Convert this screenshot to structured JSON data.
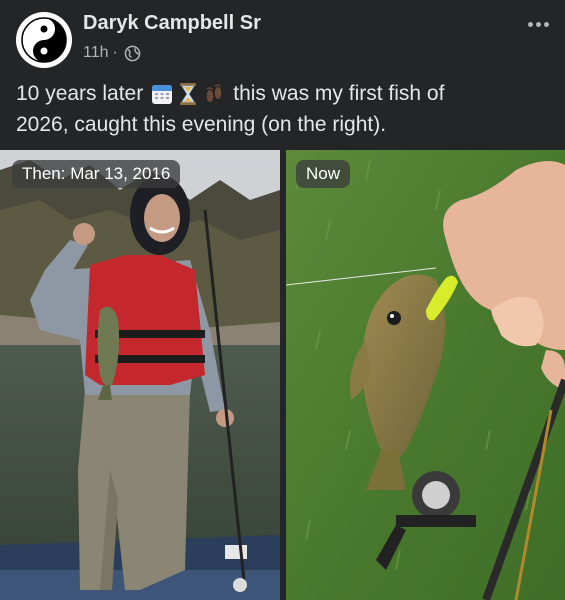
{
  "post": {
    "author": "Daryk Campbell Sr",
    "time": "11h",
    "separator": "·",
    "privacy_icon": "globe-icon",
    "more_icon": "more-options-icon",
    "text_line1_start": "10 years later",
    "text_line1_end": "this was my first fish of",
    "text_line2": "2026, caught this evening (on the right).",
    "emojis": [
      "calendar-emoji",
      "hourglass-emoji",
      "footprints-emoji"
    ]
  },
  "photos": {
    "left_label": "Then: Mar 13, 2016",
    "right_label": "Now"
  },
  "colors": {
    "background": "#242526",
    "text_primary": "#e4e6eb",
    "text_secondary": "#b0b3b8",
    "label_bg": "#3c3c3c"
  }
}
